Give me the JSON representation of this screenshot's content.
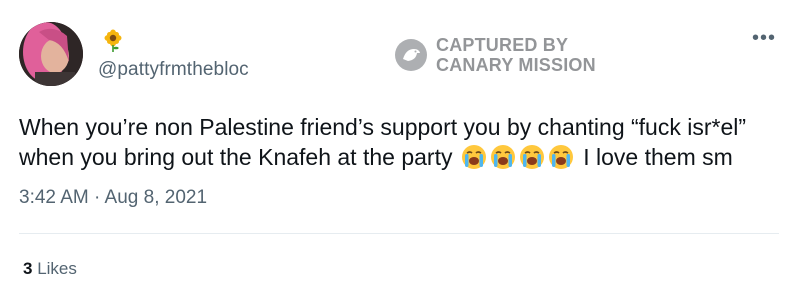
{
  "user": {
    "handle": "@pattyfrmthebloc",
    "name_emoji": "sunflower-icon"
  },
  "watermark": {
    "line1": "CAPTURED BY",
    "line2": "CANARY MISSION",
    "icon": "canary-icon"
  },
  "tweet": {
    "text_line1": "When you’re non Palestine friend’s support you by chanting “fuck isr*el”",
    "text_line2_before": "when you bring out the Knafeh at the party",
    "emojis": [
      "sob-icon",
      "sob-icon",
      "sob-icon",
      "sob-icon"
    ],
    "text_line2_after": "I love them sm",
    "timestamp": "3:42 AM · Aug 8, 2021"
  },
  "stats": {
    "likes_count": "3",
    "likes_label": "Likes"
  },
  "colors": {
    "text": "#0f1419",
    "secondary": "#536471",
    "divider": "#e6ecf0"
  }
}
